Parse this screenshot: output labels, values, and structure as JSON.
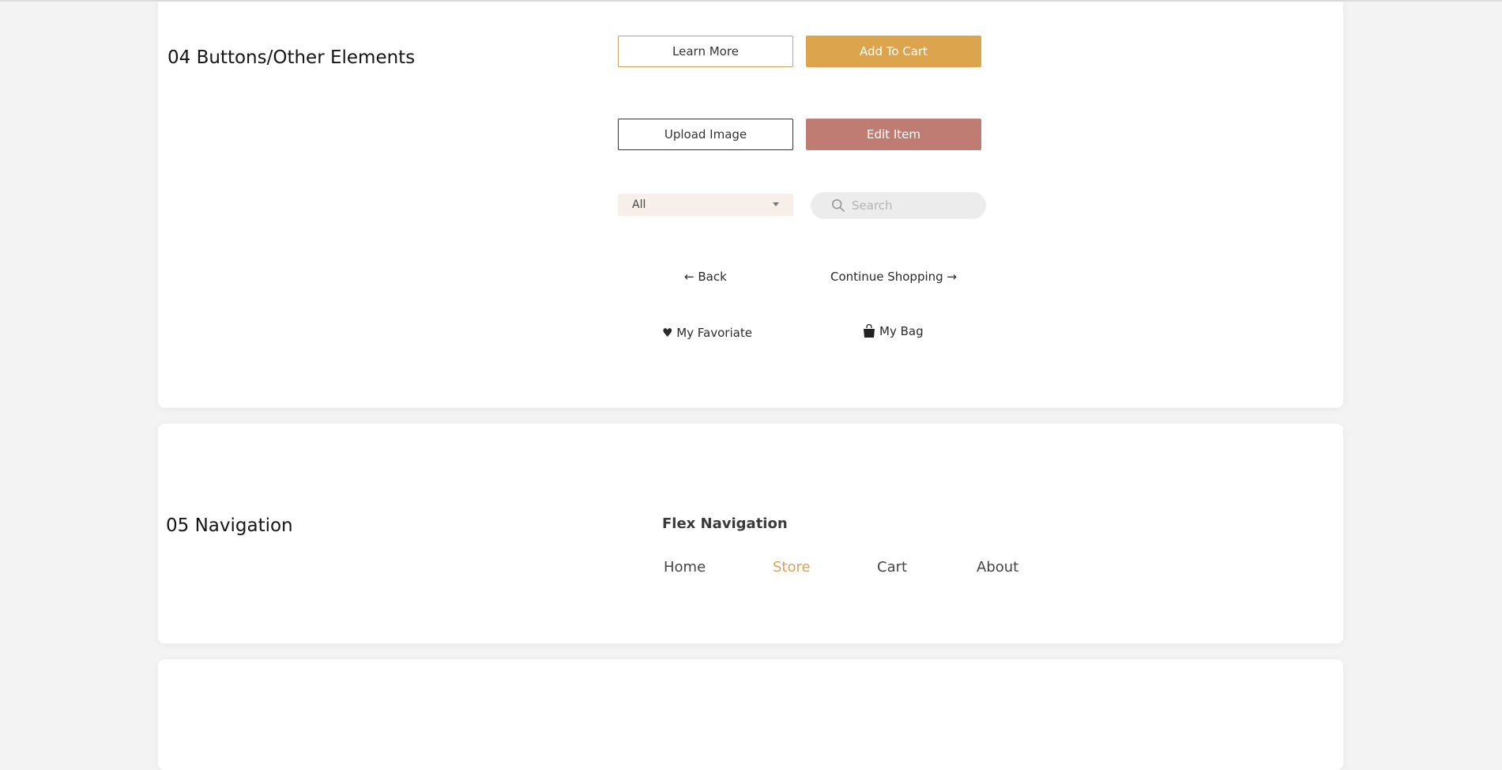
{
  "sections": {
    "buttons": {
      "title": "04 Buttons/Other Elements",
      "learn_more": "Learn More",
      "add_to_cart": "Add To Cart",
      "upload_image": "Upload Image",
      "edit_item": "Edit Item",
      "select_value": "All",
      "search_placeholder": "Search",
      "back": "← Back",
      "continue": "Continue Shopping →",
      "favorite": "♥ My Favoriate",
      "bag": "My Bag",
      "icons": [
        "caret-down-icon",
        "search-icon",
        "shopping-bag-icon"
      ]
    },
    "navigation": {
      "title": "05 Navigation",
      "subtitle": "Flex Navigation",
      "items": [
        {
          "label": "Home",
          "active": false
        },
        {
          "label": "Store",
          "active": true
        },
        {
          "label": "Cart",
          "active": false
        },
        {
          "label": "About",
          "active": false
        }
      ]
    }
  },
  "colors": {
    "gold_outline": "#c9a25d",
    "gold": "#dca44d",
    "rose": "#bf7c73",
    "select_bg": "#f8efe9",
    "search_bg": "#ececec",
    "active_nav": "#d9a15a"
  }
}
